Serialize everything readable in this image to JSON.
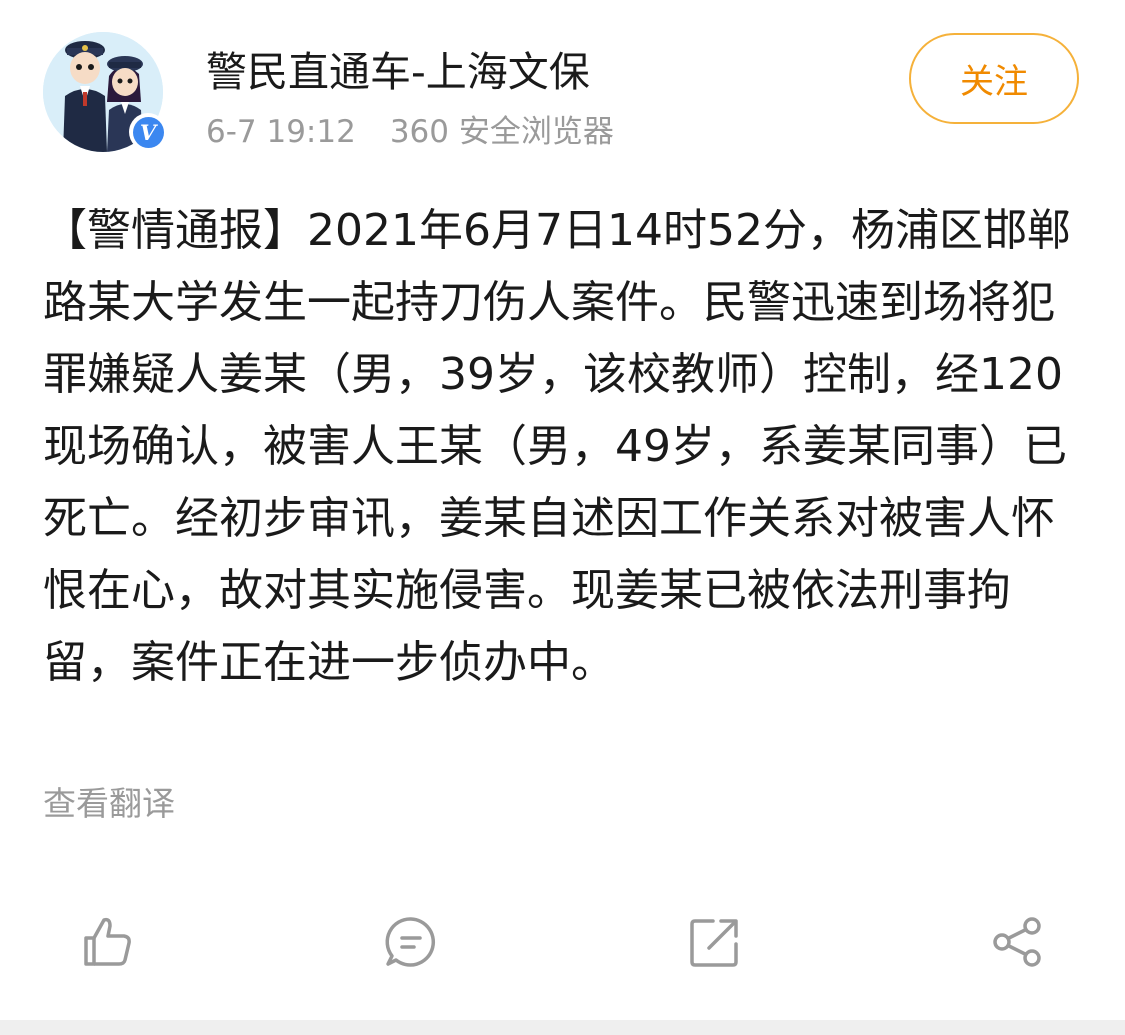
{
  "post": {
    "author": "警民直通车-上海文保",
    "time": "6-7 19:12",
    "source": "360 安全浏览器",
    "follow_label": "关注",
    "text": "【警情通报】2021年6月7日14时52分，杨浦区邯郸路某大学发生一起持刀伤人案件。民警迅速到场将犯罪嫌疑人姜某（男，39岁，该校教师）控制，经120现场确认，被害人王某（男，49岁，系姜某同事）已死亡。经初步审讯，姜某自述因工作关系对被害人怀恨在心，故对其实施侵害。现姜某已被依法刑事拘留，案件正在进一步侦办中。",
    "translate_label": "查看翻译"
  },
  "actions": [
    {
      "icon": "thumbs-up-icon"
    },
    {
      "icon": "comment-icon"
    },
    {
      "icon": "repost-icon"
    },
    {
      "icon": "share-icon"
    }
  ],
  "colors": {
    "accent": "#f08a00",
    "verified": "#3b87f0",
    "muted_text": "#9a9a9a"
  }
}
